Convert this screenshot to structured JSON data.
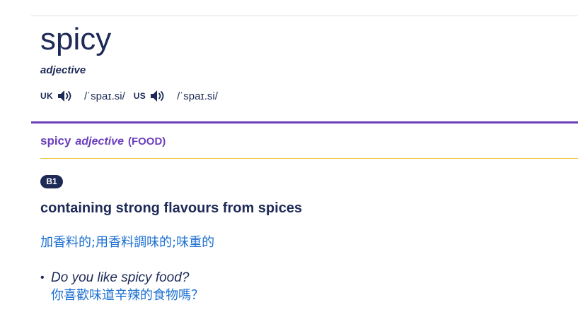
{
  "entry": {
    "headword": "spicy",
    "part_of_speech": "adjective",
    "pronunciations": [
      {
        "region": "UK",
        "ipa": "/ˈspaɪ.si/",
        "icon": "speaker-icon"
      },
      {
        "region": "US",
        "ipa": "/ˈspaɪ.si/",
        "icon": "speaker-icon"
      }
    ]
  },
  "sense": {
    "word": "spicy",
    "part_of_speech": "adjective",
    "guideword": "(FOOD)",
    "level": "B1",
    "definition": "containing strong flavours from spices",
    "translation": "加香料的;用香料調味的;味重的",
    "examples": [
      {
        "text": "Do you like spicy food?",
        "translation": "你喜歡味道辛辣的食物嗎？"
      }
    ]
  },
  "colors": {
    "headword": "#1d2a57",
    "accent_purple": "#6a3ebd",
    "translation_blue": "#1a6fd1",
    "divider_yellow": "#f0c93e",
    "badge_bg": "#1d2a57"
  }
}
